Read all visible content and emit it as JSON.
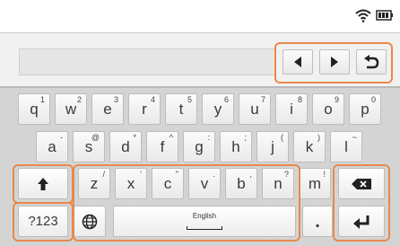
{
  "status_bar": {
    "wifi_icon": "wifi-icon",
    "battery_icon": "battery-icon"
  },
  "input_area": {
    "text_field_value": "",
    "nav_buttons": [
      {
        "name": "cursor-left-button",
        "icon": "arrow-left-icon"
      },
      {
        "name": "cursor-right-button",
        "icon": "arrow-right-icon"
      },
      {
        "name": "undo-button",
        "icon": "undo-icon"
      }
    ]
  },
  "keyboard": {
    "row1": [
      {
        "main": "q",
        "sub": "1"
      },
      {
        "main": "w",
        "sub": "2"
      },
      {
        "main": "e",
        "sub": "3"
      },
      {
        "main": "r",
        "sub": "4"
      },
      {
        "main": "t",
        "sub": "5"
      },
      {
        "main": "y",
        "sub": "6"
      },
      {
        "main": "u",
        "sub": "7"
      },
      {
        "main": "i",
        "sub": "8"
      },
      {
        "main": "o",
        "sub": "9"
      },
      {
        "main": "p",
        "sub": "0"
      }
    ],
    "row2": [
      {
        "main": "a",
        "sub": "-"
      },
      {
        "main": "s",
        "sub": "@"
      },
      {
        "main": "d",
        "sub": "*"
      },
      {
        "main": "f",
        "sub": "^"
      },
      {
        "main": "g",
        "sub": ":"
      },
      {
        "main": "h",
        "sub": ";"
      },
      {
        "main": "j",
        "sub": "("
      },
      {
        "main": "k",
        "sub": ")"
      },
      {
        "main": "l",
        "sub": "~"
      }
    ],
    "row3": [
      {
        "main": "z",
        "sub": "/"
      },
      {
        "main": "x",
        "sub": "'"
      },
      {
        "main": "c",
        "sub": "\""
      },
      {
        "main": "v",
        "sub": "."
      },
      {
        "main": "b",
        "sub": ","
      },
      {
        "main": "n",
        "sub": "?"
      },
      {
        "main": "m",
        "sub": "!"
      }
    ],
    "symbols_label": "?123",
    "space_label": "English",
    "period_label": "."
  },
  "colors": {
    "highlight": "#e8894a",
    "keyboard_bg": "#d4d4d4"
  }
}
